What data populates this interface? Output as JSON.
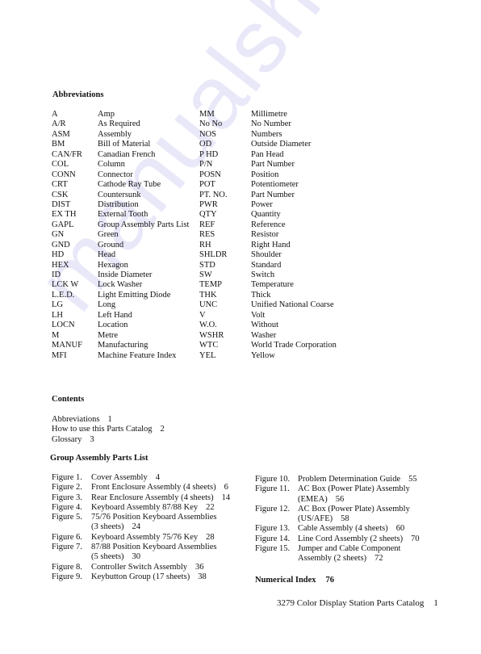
{
  "abbreviations": {
    "heading": "Abbreviations",
    "rows": [
      {
        "a1": "A",
        "d1": "Amp",
        "a2": "MM",
        "d2": "Millimetre"
      },
      {
        "a1": "A/R",
        "d1": "As Required",
        "a2": "No No",
        "d2": "No Number"
      },
      {
        "a1": "ASM",
        "d1": "Assembly",
        "a2": "NOS",
        "d2": "Numbers"
      },
      {
        "a1": "BM",
        "d1": "Bill of Material",
        "a2": "OD",
        "d2": "Outside Diameter"
      },
      {
        "a1": "CAN/FR",
        "d1": "Canadian French",
        "a2": "P HD",
        "d2": "Pan Head"
      },
      {
        "a1": "COL",
        "d1": "Column",
        "a2": "P/N",
        "d2": "Part Number"
      },
      {
        "a1": "CONN",
        "d1": "Connector",
        "a2": "POSN",
        "d2": "Position"
      },
      {
        "a1": "CRT",
        "d1": "Cathode Ray Tube",
        "a2": "POT",
        "d2": "Potentiometer"
      },
      {
        "a1": "CSK",
        "d1": "Countersunk",
        "a2": "PT. NO.",
        "d2": "Part Number"
      },
      {
        "a1": "DIST",
        "d1": "Distribution",
        "a2": "PWR",
        "d2": "Power"
      },
      {
        "a1": "EX TH",
        "d1": "External Tooth",
        "a2": "QTY",
        "d2": "Quantity"
      },
      {
        "a1": "GAPL",
        "d1": "Group Assembly Parts List",
        "a2": "REF",
        "d2": "Reference"
      },
      {
        "a1": "GN",
        "d1": "Green",
        "a2": "RES",
        "d2": "Resistor"
      },
      {
        "a1": "GND",
        "d1": "Ground",
        "a2": "RH",
        "d2": "Right Hand"
      },
      {
        "a1": "HD",
        "d1": "Head",
        "a2": "SHLDR",
        "d2": "Shoulder"
      },
      {
        "a1": "HEX",
        "d1": "Hexagon",
        "a2": "STD",
        "d2": "Standard"
      },
      {
        "a1": "ID",
        "d1": "Inside Diameter",
        "a2": "SW",
        "d2": "Switch"
      },
      {
        "a1": "LCK W",
        "d1": "Lock Washer",
        "a2": "TEMP",
        "d2": "Temperature"
      },
      {
        "a1": "L.E.D.",
        "d1": "Light Emitting Diode",
        "a2": "THK",
        "d2": "Thick"
      },
      {
        "a1": "LG",
        "d1": "Long",
        "a2": "UNC",
        "d2": "Unified National Coarse"
      },
      {
        "a1": "LH",
        "d1": "Left Hand",
        "a2": "V",
        "d2": "Volt"
      },
      {
        "a1": "LOCN",
        "d1": "Location",
        "a2": "W.O.",
        "d2": "Without"
      },
      {
        "a1": "M",
        "d1": "Metre",
        "a2": "WSHR",
        "d2": "Washer"
      },
      {
        "a1": "MANUF",
        "d1": "Manufacturing",
        "a2": "WTC",
        "d2": "World Trade Corporation"
      },
      {
        "a1": "MFI",
        "d1": "Machine Feature Index",
        "a2": "YEL",
        "d2": "Yellow"
      }
    ]
  },
  "contents": {
    "heading": "Contents",
    "items": [
      {
        "title": "Abbreviations",
        "page": "1"
      },
      {
        "title": "How to use this Parts Catalog",
        "page": "2"
      },
      {
        "title": "Glossary",
        "page": "3"
      }
    ]
  },
  "gapl": {
    "heading": "Group Assembly Parts List",
    "left": [
      {
        "label": "Figure 1.",
        "lines": [
          "Cover Assembly"
        ],
        "page": "4"
      },
      {
        "label": "Figure 2.",
        "lines": [
          "Front Enclosure Assembly (4 sheets)"
        ],
        "page": "6"
      },
      {
        "label": "Figure 3.",
        "lines": [
          "Rear Enclosure Assembly (4 sheets)"
        ],
        "page": "14"
      },
      {
        "label": "Figure 4.",
        "lines": [
          "Keyboard Assembly 87/88 Key"
        ],
        "page": "22"
      },
      {
        "label": "Figure 5.",
        "lines": [
          "75/76 Position Keyboard Assemblies",
          "(3 sheets)"
        ],
        "page": "24"
      },
      {
        "label": "Figure 6.",
        "lines": [
          "Keyboard Assembly 75/76 Key"
        ],
        "page": "28"
      },
      {
        "label": "Figure 7.",
        "lines": [
          "87/88 Position Keyboard Assemblies",
          "(5 sheets)"
        ],
        "page": "30"
      },
      {
        "label": "Figure 8.",
        "lines": [
          "Controller Switch Assembly"
        ],
        "page": "36"
      },
      {
        "label": "Figure 9.",
        "lines": [
          "Keybutton Group (17 sheets)"
        ],
        "page": "38"
      }
    ],
    "right": [
      {
        "label": "Figure 10.",
        "lines": [
          "Problem Determination Guide"
        ],
        "page": "55"
      },
      {
        "label": "Figure 11.",
        "lines": [
          "AC Box (Power Plate) Assembly",
          "(EMEA)"
        ],
        "page": "56"
      },
      {
        "label": "Figure 12.",
        "lines": [
          "AC Box (Power Plate) Assembly",
          "(US/AFE)"
        ],
        "page": "58"
      },
      {
        "label": "Figure 13.",
        "lines": [
          "Cable Assembly (4 sheets)"
        ],
        "page": "60"
      },
      {
        "label": "Figure 14.",
        "lines": [
          "Line Cord Assembly (2 sheets)"
        ],
        "page": "70"
      },
      {
        "label": "Figure 15.",
        "lines": [
          "Jumper and Cable Component",
          "Assembly (2 sheets)"
        ],
        "page": "72"
      }
    ]
  },
  "numerical_index": {
    "title": "Numerical Index",
    "page": "76"
  },
  "footer": {
    "title": "3279 Color Display Station Parts Catalog",
    "page": "1"
  },
  "watermark": "manualshive"
}
